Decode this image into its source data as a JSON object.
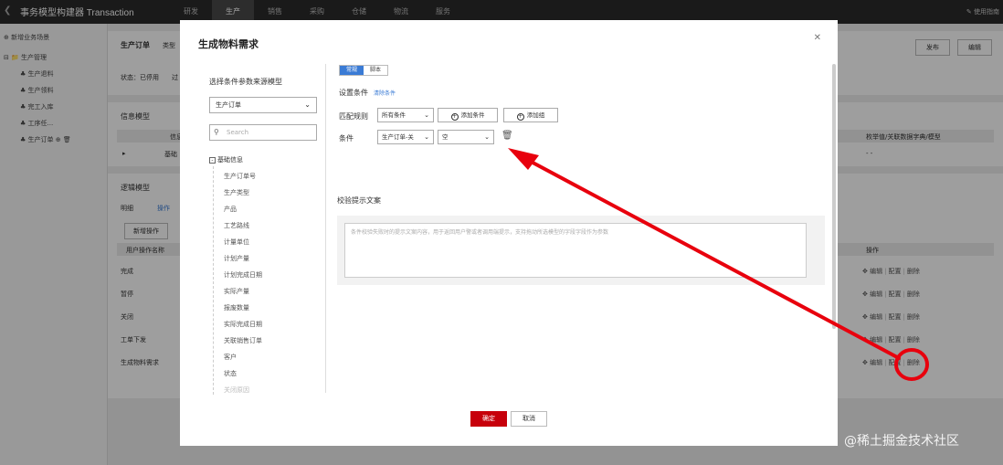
{
  "topbar": {
    "title": "事务模型构建器 Transaction",
    "nav": [
      "研发",
      "生产",
      "销售",
      "采购",
      "仓储",
      "物流",
      "服务"
    ],
    "active_nav": "生产",
    "usage": "使用指南"
  },
  "sidebar": {
    "add_scene": "新增业务场景",
    "group": "生产管理",
    "items": [
      "生产退料",
      "生产领料",
      "完工入库",
      "工序任...",
      "生产订单"
    ]
  },
  "page": {
    "title": "生产订单",
    "type_label": "类型",
    "status": "状态：已停用",
    "status_extra": "过",
    "publish": "发布",
    "edit": "编辑",
    "info_model": "信息模型",
    "info_col1": "信息",
    "info_col_right": "枚举值/关联数据字典/模型",
    "info_row1": "基础",
    "info_row_dash": "- -",
    "logic_model": "逻辑模型",
    "tab_detail": "明细",
    "tab_ops": "操作",
    "add_op": "新增操作",
    "ops_name_col": "用户操作名称",
    "ops_col": "操作",
    "rows": [
      "完成",
      "暂停",
      "关闭",
      "工单下发",
      "生成物料需求"
    ],
    "row_ops": [
      "编辑",
      "配置",
      "删除"
    ]
  },
  "modal": {
    "title": "生成物料需求",
    "left_label": "选择条件参数来源模型",
    "source_model": "生产订单",
    "search_placeholder": "Search",
    "tree_root": "基础信息",
    "tree_items": [
      "生产订单号",
      "生产类型",
      "产品",
      "工艺路线",
      "计量单位",
      "计划产量",
      "计划完成日期",
      "实际产量",
      "报废数量",
      "实际完成日期",
      "关联销售订单",
      "客户",
      "状态",
      "关闭原因"
    ],
    "seg_normal": "常规",
    "seg_script": "脚本",
    "set_condition": "设置条件",
    "clear_condition": "清除条件",
    "match_rule": "匹配规则",
    "match_value": "所有条件",
    "add_condition": "添加条件",
    "add_group": "添加组",
    "condition_label": "条件",
    "condition_field": "生产订单-关",
    "condition_op": "空",
    "tip_label": "校验提示文案",
    "tip_placeholder": "条件校验失败时的提示文案内容，用于返回用户警或者调用端提示，支持拖动所选模型的字段字段作为参数",
    "confirm": "确定",
    "cancel": "取消"
  },
  "watermark": "@稀土掘金技术社区",
  "colors": {
    "primary_red": "#c7000b",
    "tab_blue": "#3a7bd5",
    "annotation_red": "#e8000d"
  }
}
